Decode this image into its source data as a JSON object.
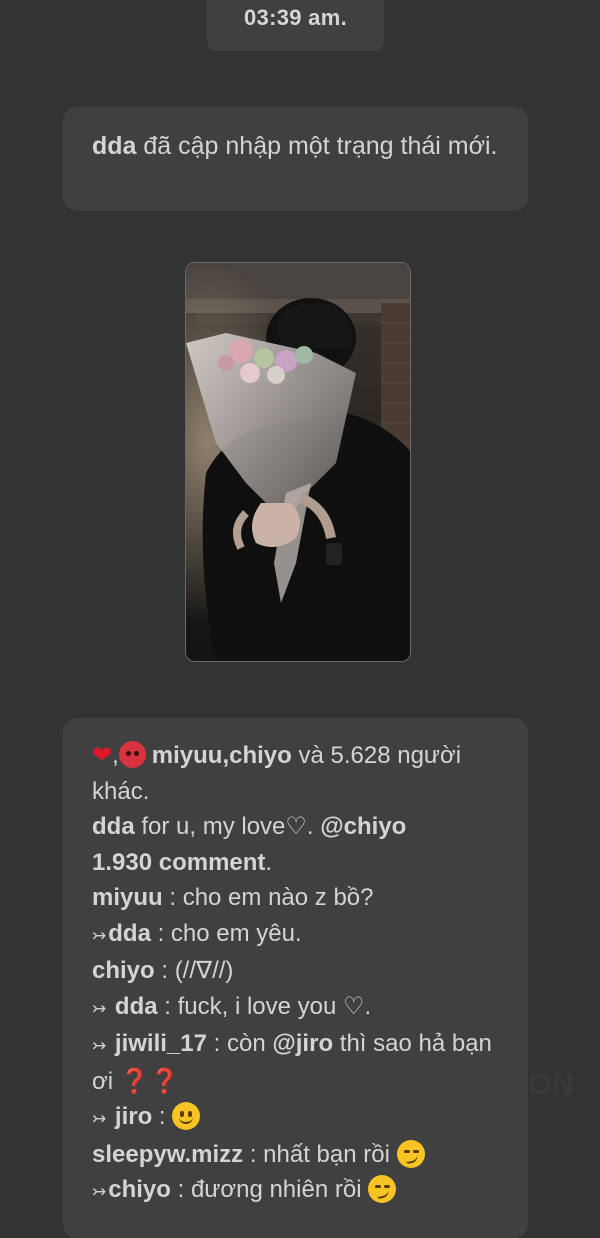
{
  "timestamp": "03:39 am.",
  "status_update": {
    "user": "dda",
    "text": " đã cập nhập một trạng thái mới."
  },
  "photo": {
    "description_icon": "photo-image"
  },
  "post": {
    "reaction_icons": [
      "heart-icon",
      "angry-face-icon"
    ],
    "reaction_sep": ",",
    "liked_by": "miyuu,chiyo",
    "liked_others": " và 5.628 người khác.",
    "caption_user": "dda",
    "caption_text": " for u, my love♡. ",
    "caption_mention": "@chiyo",
    "comment_count": "1.930 comment",
    "comment_count_suffix": "."
  },
  "comments": [
    {
      "reply": false,
      "user": "miyuu",
      "text": " : cho em nào z bồ?"
    },
    {
      "reply": true,
      "user": "dda",
      "text": " : cho em yêu."
    },
    {
      "reply": false,
      "user": "chiyo",
      "text": " : (//∇//)"
    },
    {
      "reply": true,
      "user": "dda",
      "text": " : fuck, i love you ♡."
    },
    {
      "reply": true,
      "user": "jiwili_17",
      "text": " : còn ",
      "mention": "@jiro",
      "text2": " thì sao hả bạn ơi ",
      "tail": "❓❓"
    },
    {
      "reply": true,
      "user": "jiro",
      "text": " : ",
      "emoji": "slightly-smiling-face-icon"
    },
    {
      "reply": false,
      "user": "sleepyw.mizz",
      "text": " : nhất bạn rồi ",
      "emoji": "smirking-face-icon"
    },
    {
      "reply": true,
      "user": "chiyo",
      "text": " : đương nhiên rồi ",
      "emoji": "smirking-face-icon"
    }
  ],
  "reply_arrow": "↣",
  "watermark": "ON",
  "colors": {
    "background": "#333334",
    "card": "#404040",
    "text": "#d4d4d4",
    "heart": "#e0162b"
  }
}
